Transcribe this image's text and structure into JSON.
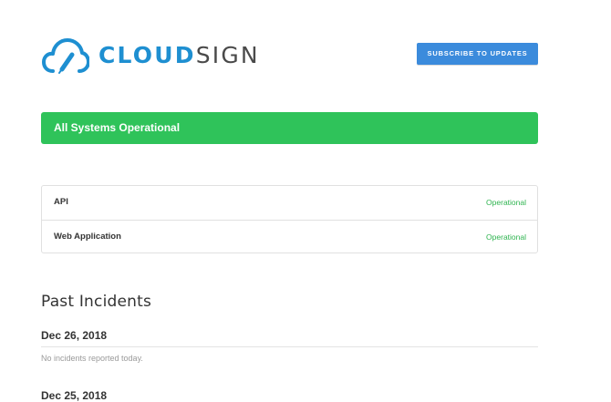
{
  "brand": {
    "name_part1": "CLOUD",
    "name_part2": "SIGN",
    "accent_color": "#1e8fd1",
    "icon": "cloud-pen-icon"
  },
  "header": {
    "subscribe_label": "SUBSCRIBE TO UPDATES"
  },
  "status_banner": {
    "text": "All Systems Operational",
    "color": "#2fc35a"
  },
  "components": [
    {
      "name": "API",
      "status": "Operational"
    },
    {
      "name": "Web Application",
      "status": "Operational"
    }
  ],
  "past_incidents": {
    "title": "Past Incidents",
    "days": [
      {
        "date": "Dec 26, 2018",
        "message": "No incidents reported today."
      },
      {
        "date": "Dec 25, 2018"
      }
    ]
  }
}
